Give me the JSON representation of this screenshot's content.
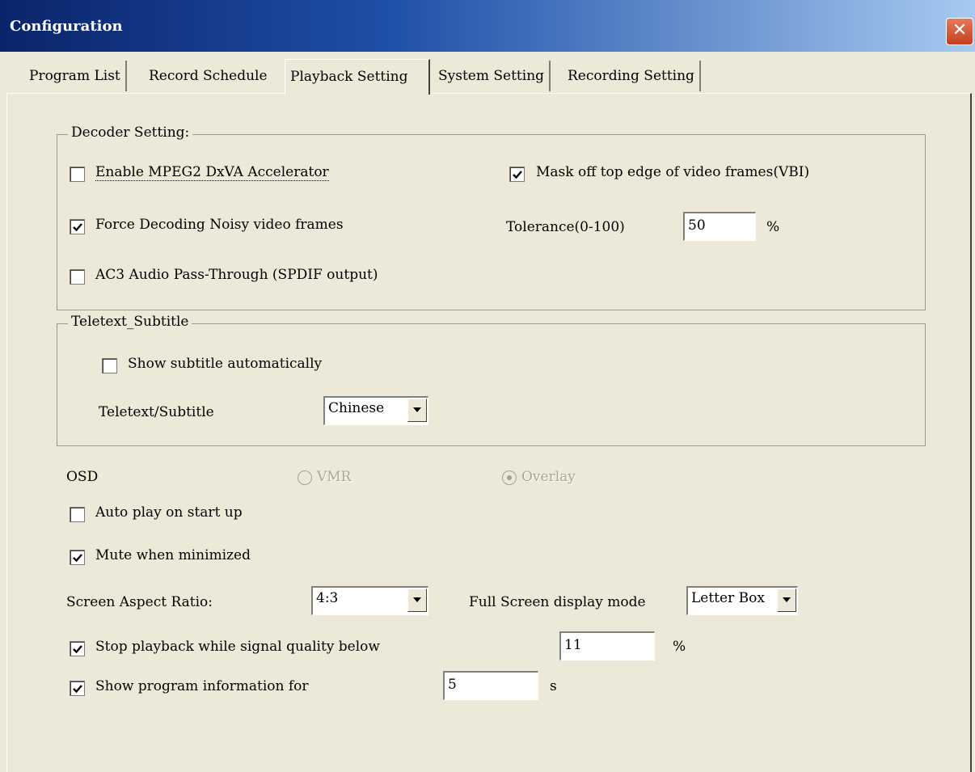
{
  "window": {
    "title": "Configuration",
    "close_icon": "close-icon"
  },
  "tabs": [
    {
      "label": "Program List"
    },
    {
      "label": "Record Schedule"
    },
    {
      "label": "Playback Setting",
      "active": true
    },
    {
      "label": "System Setting"
    },
    {
      "label": "Recording Setting"
    }
  ],
  "decoder": {
    "group_title": "Decoder Setting:",
    "dxva": {
      "label": "Enable MPEG2 DxVA Accelerator",
      "checked": false
    },
    "force_decoding": {
      "label": "Force Decoding Noisy video frames",
      "checked": true
    },
    "ac3": {
      "label": "AC3 Audio Pass-Through (SPDIF output)",
      "checked": false
    },
    "mask_vbi": {
      "label": "Mask off top edge of video frames(VBI)",
      "checked": true
    },
    "tolerance": {
      "label": "Tolerance(0-100)",
      "value": "50",
      "unit": "%"
    }
  },
  "teletext": {
    "group_title": "Teletext_Subtitle",
    "auto_subtitle": {
      "label": "Show subtitle automatically",
      "checked": false
    },
    "language": {
      "label": "Teletext/Subtitle",
      "selected": "Chinese"
    }
  },
  "osd": {
    "label": "OSD",
    "options": [
      {
        "label": "VMR",
        "selected": false,
        "disabled": true
      },
      {
        "label": "Overlay",
        "selected": true,
        "disabled": true
      }
    ]
  },
  "auto_play": {
    "label": "Auto play on start up",
    "checked": false
  },
  "mute_minimized": {
    "label": "Mute when minimized",
    "checked": true
  },
  "aspect_ratio": {
    "label": "Screen Aspect Ratio:",
    "selected": "4:3"
  },
  "fullscreen_mode": {
    "label": "Full Screen display mode",
    "selected": "Letter Box"
  },
  "stop_playback": {
    "label": "Stop playback while signal quality below",
    "checked": true,
    "value": "11",
    "unit": "%"
  },
  "show_info": {
    "label": "Show program information for",
    "checked": true,
    "value": "5",
    "unit": "s"
  }
}
